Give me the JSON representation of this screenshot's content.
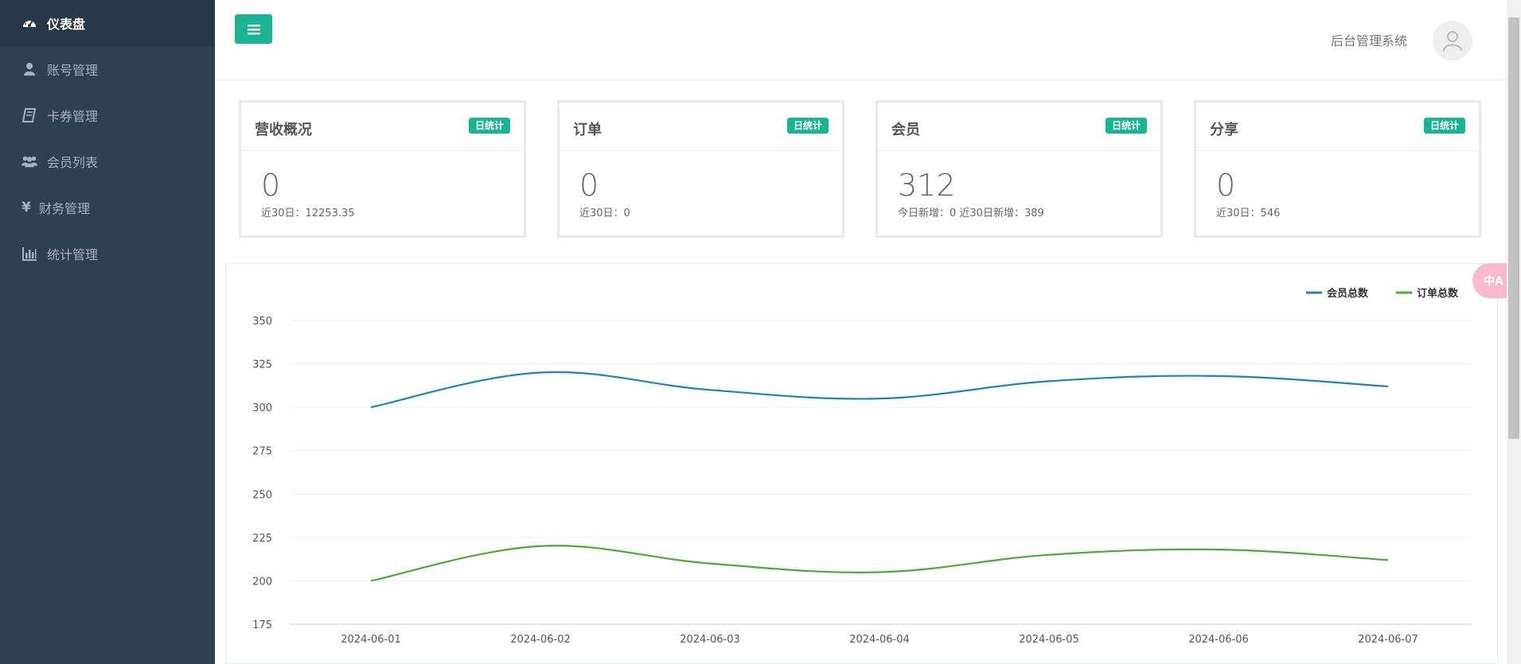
{
  "sidebar": {
    "items": [
      {
        "label": "仪表盘",
        "icon": "dashboard-icon",
        "active": true
      },
      {
        "label": "账号管理",
        "icon": "user-icon",
        "active": false
      },
      {
        "label": "卡券管理",
        "icon": "book-icon",
        "active": false
      },
      {
        "label": "会员列表",
        "icon": "users-icon",
        "active": false
      },
      {
        "label": "财务管理",
        "icon": "yen-icon",
        "active": false
      },
      {
        "label": "统计管理",
        "icon": "bar-chart-icon",
        "active": false
      }
    ]
  },
  "header": {
    "system_title": "后台管理系统",
    "menu_icon": "hamburger-icon",
    "avatar_icon": "user-avatar-icon"
  },
  "cards": [
    {
      "title": "营收概况",
      "badge": "日统计",
      "value": "0",
      "sub": "近30日：12253.35"
    },
    {
      "title": "订单",
      "badge": "日统计",
      "value": "0",
      "sub": "近30日：0"
    },
    {
      "title": "会员",
      "badge": "日统计",
      "value": "312",
      "sub": "今日新增：0 近30日新增：389"
    },
    {
      "title": "分享",
      "badge": "日统计",
      "value": "0",
      "sub": "近30日：546"
    }
  ],
  "translate_button": {
    "label": "中A",
    "icon": "translate-icon"
  },
  "colors": {
    "sidebar_bg": "#2f4050",
    "accent": "#1ab394",
    "series_members": "#1985b9",
    "series_orders": "#4daa34"
  },
  "chart_data": {
    "type": "line",
    "x": [
      "2024-06-01",
      "2024-06-02",
      "2024-06-03",
      "2024-06-04",
      "2024-06-05",
      "2024-06-06",
      "2024-06-07"
    ],
    "series": [
      {
        "name": "会员总数",
        "values": [
          300,
          320,
          310,
          305,
          315,
          318,
          312
        ],
        "color": "#1985b9"
      },
      {
        "name": "订单总数",
        "values": [
          200,
          220,
          210,
          205,
          215,
          218,
          212
        ],
        "color": "#4daa34"
      }
    ],
    "ylim": [
      175,
      350
    ],
    "yticks": [
      175,
      200,
      225,
      250,
      275,
      300,
      325,
      350
    ],
    "smooth": true,
    "grid": true,
    "legend": "top-right"
  }
}
